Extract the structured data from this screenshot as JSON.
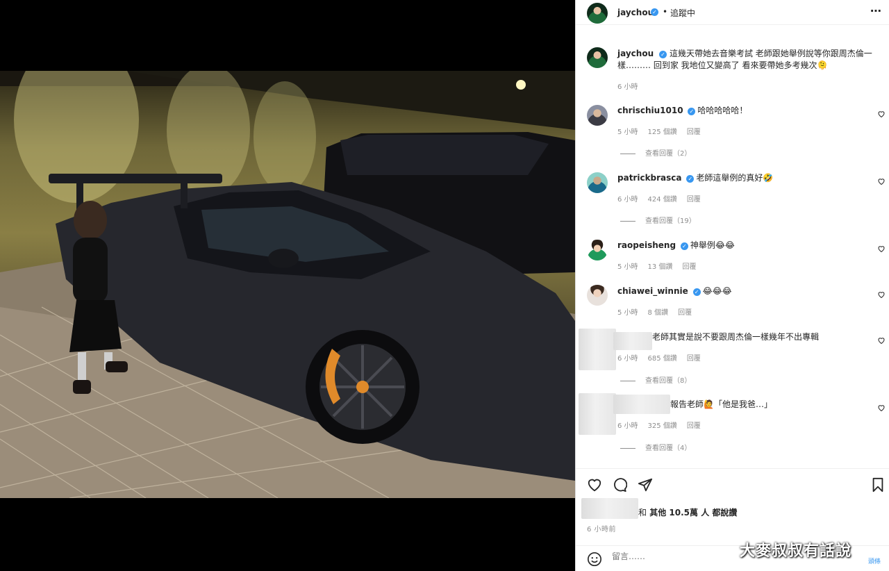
{
  "post": {
    "author": "jaychou",
    "follow_status": "追蹤中",
    "dot": "•",
    "caption_user": "jaychou",
    "caption": "這幾天帶她去音樂考試 老師跟她舉例說等你跟周杰倫一樣……… 回到家 我地位又變高了 看來要帶她多考幾次🫠",
    "caption_time": "6 小時"
  },
  "comments": [
    {
      "user": "chrischiu1010",
      "verified": true,
      "text": "哈哈哈哈哈！",
      "time": "5 小時",
      "likes": "125 個讚",
      "reply": "回覆",
      "view_replies": "查看回覆（2）"
    },
    {
      "user": "patrickbrasca",
      "verified": true,
      "text": "老師這舉例的真好🤣",
      "time": "6 小時",
      "likes": "424 個讚",
      "reply": "回覆",
      "view_replies": "查看回覆（19）"
    },
    {
      "user": "raopeisheng",
      "verified": true,
      "text": "神舉例😂😂",
      "time": "5 小時",
      "likes": "13 個讚",
      "reply": "回覆",
      "view_replies": ""
    },
    {
      "user": "chiawei_winnie",
      "verified": true,
      "text": "😂😂😂",
      "time": "5 小時",
      "likes": "8 個讚",
      "reply": "回覆",
      "view_replies": ""
    },
    {
      "user": "",
      "verified": false,
      "text": "老師其實是說不要跟周杰倫一樣幾年不出專輯",
      "time": "6 小時",
      "likes": "685 個讚",
      "reply": "回覆",
      "view_replies": "查看回覆（8）"
    },
    {
      "user": "",
      "verified": false,
      "text": "報告老師🙋「他是我爸…」",
      "time": "6 小時",
      "likes": "325 個讚",
      "reply": "回覆",
      "view_replies": "查看回覆（4）"
    }
  ],
  "likes": {
    "prefix": "和",
    "others_label": "其他",
    "count": "10.5萬",
    "suffix": "人 都說讚"
  },
  "posted_ago": "6 小時前",
  "comment_box": {
    "placeholder": "留言……"
  },
  "watermark": {
    "text": "大麥叔叔有話說",
    "sub": "頭條"
  },
  "icons": {
    "more": "more-horizontal-icon",
    "like": "heart-icon",
    "comment": "comment-bubble-icon",
    "share": "paper-plane-icon",
    "save": "bookmark-icon",
    "emoji": "smiley-icon"
  },
  "colors": {
    "verified": "#3897f0",
    "muted": "#8e8e8e",
    "text": "#262626"
  }
}
